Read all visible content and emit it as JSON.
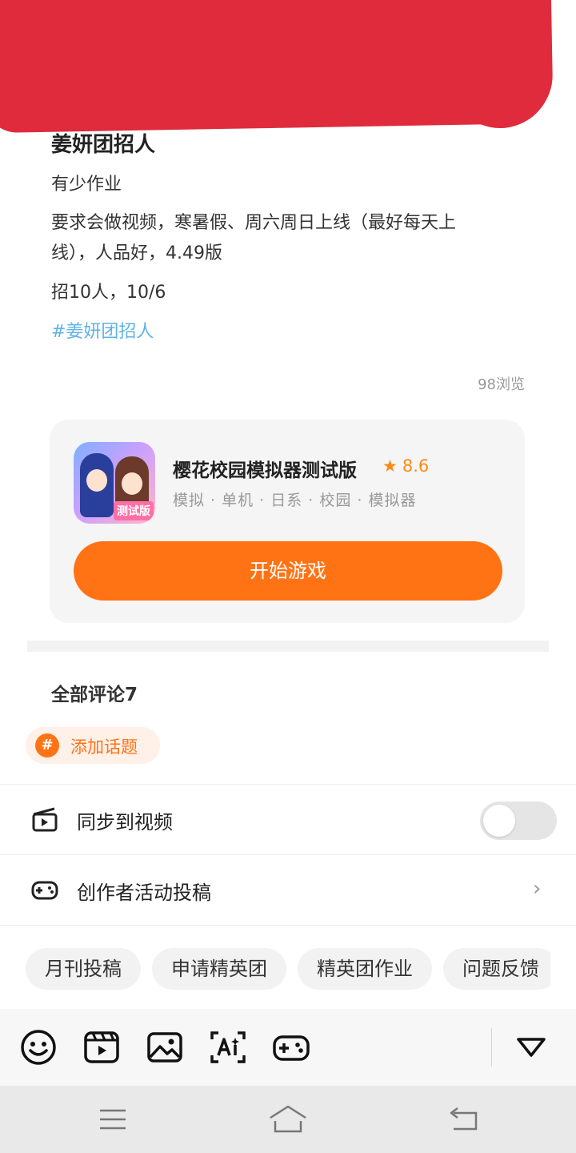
{
  "post": {
    "title": "姜妍团招人",
    "line1": "有少作业",
    "line2a": "要求会做视频，寒暑假、周六周日上线（最好每天上",
    "line2b": "线），人品好，4.49版",
    "line3": "招10人，10/6",
    "hashtag": "#姜妍团招人",
    "views": "98浏览"
  },
  "game": {
    "name": "樱花校园模拟器测试版",
    "rating": "8.6",
    "icon_badge": "测试版",
    "tags": "模拟 · 单机 · 日系 · 校园 · 模拟器",
    "play_label": "开始游戏"
  },
  "comments": {
    "title": "全部评论7"
  },
  "compose": {
    "add_topic": "添加话题",
    "sync_video": "同步到视频",
    "sync_video_on": false,
    "creator_submit": "创作者活动投稿",
    "chips": [
      "月刊投稿",
      "申请精英团",
      "精英团作业",
      "问题反馈"
    ]
  },
  "icons": {
    "toolbar": [
      "emoji-icon",
      "video-icon",
      "image-icon",
      "ai-icon",
      "game-icon",
      "collapse-icon"
    ],
    "nav": [
      "menu-icon",
      "home-icon",
      "back-icon"
    ]
  },
  "colors": {
    "accent": "#ff7314",
    "hashtag": "#5fb3e6",
    "redaction": "#e02b3c"
  }
}
